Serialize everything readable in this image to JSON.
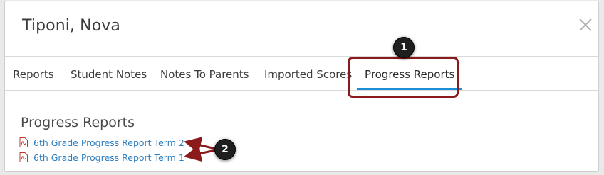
{
  "dialog": {
    "title": "Tiponi, Nova"
  },
  "tabs": [
    {
      "label": "Reports"
    },
    {
      "label": "Student Notes"
    },
    {
      "label": "Notes To Parents"
    },
    {
      "label": "Imported Scores"
    },
    {
      "label": "Progress Reports",
      "active": true
    }
  ],
  "main": {
    "section_title": "Progress Reports",
    "reports": [
      {
        "label": "6th Grade Progress Report Term 2",
        "icon": "pdf-icon"
      },
      {
        "label": "6th Grade Progress Report Term 1",
        "icon": "pdf-icon"
      }
    ]
  },
  "callouts": [
    {
      "label": "1"
    },
    {
      "label": "2"
    }
  ],
  "colors": {
    "active_tab_underline": "#1a8fd8",
    "callout_highlight": "#8b1a1a",
    "link": "#2f7fc1",
    "pdf_icon": "#c0392b"
  }
}
